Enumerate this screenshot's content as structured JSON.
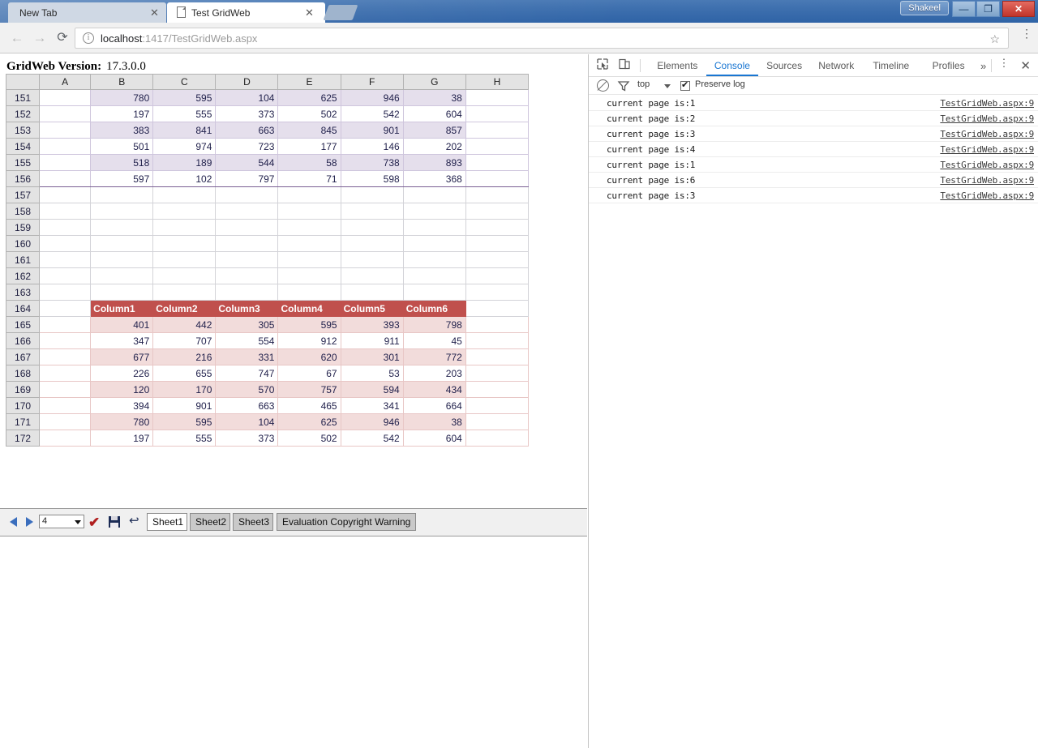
{
  "window": {
    "user_button": "Shakeel",
    "minimize": "—",
    "maximize": "❐",
    "close": "✕"
  },
  "browser": {
    "tabs": [
      {
        "title": "New Tab",
        "active": false,
        "close": "✕"
      },
      {
        "title": "Test GridWeb",
        "active": true,
        "close": "✕"
      }
    ],
    "new_tab_button": "",
    "back": "←",
    "forward": "→",
    "reload": "⟳",
    "url_host": "localhost",
    "url_path": ":1417/TestGridWeb.aspx",
    "info_glyph": "i",
    "bookmark_star": "☆",
    "menu_glyph": "⋮"
  },
  "page": {
    "version_label": "GridWeb Version:",
    "version_value": "17.3.0.0",
    "grid": {
      "column_headers": [
        "A",
        "B",
        "C",
        "D",
        "E",
        "F",
        "G",
        "H"
      ],
      "rows": [
        {
          "num": "151",
          "cells": [
            "",
            "780",
            "595",
            "104",
            "625",
            "946",
            "38",
            ""
          ],
          "zone": "purple",
          "alt": true,
          "first": true
        },
        {
          "num": "152",
          "cells": [
            "",
            "197",
            "555",
            "373",
            "502",
            "542",
            "604",
            ""
          ],
          "zone": "purple",
          "alt": false
        },
        {
          "num": "153",
          "cells": [
            "",
            "383",
            "841",
            "663",
            "845",
            "901",
            "857",
            ""
          ],
          "zone": "purple",
          "alt": true
        },
        {
          "num": "154",
          "cells": [
            "",
            "501",
            "974",
            "723",
            "177",
            "146",
            "202",
            ""
          ],
          "zone": "purple",
          "alt": false
        },
        {
          "num": "155",
          "cells": [
            "",
            "518",
            "189",
            "544",
            "58",
            "738",
            "893",
            ""
          ],
          "zone": "purple",
          "alt": true
        },
        {
          "num": "156",
          "cells": [
            "",
            "597",
            "102",
            "797",
            "71",
            "598",
            "368",
            ""
          ],
          "zone": "purple",
          "alt": false,
          "last": true
        },
        {
          "num": "157",
          "cells": [
            "",
            "",
            "",
            "",
            "",
            "",
            "",
            ""
          ],
          "zone": "none"
        },
        {
          "num": "158",
          "cells": [
            "",
            "",
            "",
            "",
            "",
            "",
            "",
            ""
          ],
          "zone": "none"
        },
        {
          "num": "159",
          "cells": [
            "",
            "",
            "",
            "",
            "",
            "",
            "",
            ""
          ],
          "zone": "none"
        },
        {
          "num": "160",
          "cells": [
            "",
            "",
            "",
            "",
            "",
            "",
            "",
            ""
          ],
          "zone": "none"
        },
        {
          "num": "161",
          "cells": [
            "",
            "",
            "",
            "",
            "",
            "",
            "",
            ""
          ],
          "zone": "none"
        },
        {
          "num": "162",
          "cells": [
            "",
            "",
            "",
            "",
            "",
            "",
            "",
            ""
          ],
          "zone": "none"
        },
        {
          "num": "163",
          "cells": [
            "",
            "",
            "",
            "",
            "",
            "",
            "",
            ""
          ],
          "zone": "none"
        },
        {
          "num": "164",
          "cells": [
            "",
            "Column1",
            "Column2",
            "Column3",
            "Column4",
            "Column5",
            "Column6",
            ""
          ],
          "zone": "redhead"
        },
        {
          "num": "165",
          "cells": [
            "",
            "401",
            "442",
            "305",
            "595",
            "393",
            "798",
            ""
          ],
          "zone": "red",
          "alt": true
        },
        {
          "num": "166",
          "cells": [
            "",
            "347",
            "707",
            "554",
            "912",
            "911",
            "45",
            ""
          ],
          "zone": "red",
          "alt": false
        },
        {
          "num": "167",
          "cells": [
            "",
            "677",
            "216",
            "331",
            "620",
            "301",
            "772",
            ""
          ],
          "zone": "red",
          "alt": true
        },
        {
          "num": "168",
          "cells": [
            "",
            "226",
            "655",
            "747",
            "67",
            "53",
            "203",
            ""
          ],
          "zone": "red",
          "alt": false
        },
        {
          "num": "169",
          "cells": [
            "",
            "120",
            "170",
            "570",
            "757",
            "594",
            "434",
            ""
          ],
          "zone": "red",
          "alt": true
        },
        {
          "num": "170",
          "cells": [
            "",
            "394",
            "901",
            "663",
            "465",
            "341",
            "664",
            ""
          ],
          "zone": "red",
          "alt": false
        },
        {
          "num": "171",
          "cells": [
            "",
            "780",
            "595",
            "104",
            "625",
            "946",
            "38",
            ""
          ],
          "zone": "red",
          "alt": true
        },
        {
          "num": "172",
          "cells": [
            "",
            "197",
            "555",
            "373",
            "502",
            "542",
            "604",
            ""
          ],
          "zone": "red",
          "alt": false
        }
      ]
    },
    "toolbar": {
      "prev_label": "previous-page",
      "next_label": "next-page",
      "page_value": "4",
      "submit_label": "submit",
      "save_label": "save",
      "undo_label": "undo",
      "sheets": [
        {
          "label": "Sheet1",
          "active": true
        },
        {
          "label": "Sheet2",
          "active": false
        },
        {
          "label": "Sheet3",
          "active": false
        }
      ],
      "evaluation_warning": "Evaluation Copyright Warning"
    }
  },
  "devtools": {
    "tabs": [
      {
        "label": "Elements",
        "selected": false
      },
      {
        "label": "Console",
        "selected": true
      },
      {
        "label": "Sources",
        "selected": false
      },
      {
        "label": "Network",
        "selected": false
      },
      {
        "label": "Timeline",
        "selected": false
      },
      {
        "label": "Profiles",
        "selected": false
      }
    ],
    "more_tabs": "»",
    "kebab": "⋮",
    "close": "✕",
    "filter": {
      "context": "top",
      "preserve_log": "Preserve log",
      "preserve_log_checked": true
    },
    "console_rows": [
      {
        "message": "current page is:1",
        "source": "TestGridWeb.aspx:9"
      },
      {
        "message": "current page is:2",
        "source": "TestGridWeb.aspx:9"
      },
      {
        "message": "current page is:3",
        "source": "TestGridWeb.aspx:9"
      },
      {
        "message": "current page is:4",
        "source": "TestGridWeb.aspx:9"
      },
      {
        "message": "current page is:1",
        "source": "TestGridWeb.aspx:9"
      },
      {
        "message": "current page is:6",
        "source": "TestGridWeb.aspx:9"
      },
      {
        "message": "current page is:3",
        "source": "TestGridWeb.aspx:9"
      }
    ],
    "annotation": {
      "shape": "red-rounded-rectangle-with-up-arrow",
      "color": "#e8252a"
    }
  }
}
